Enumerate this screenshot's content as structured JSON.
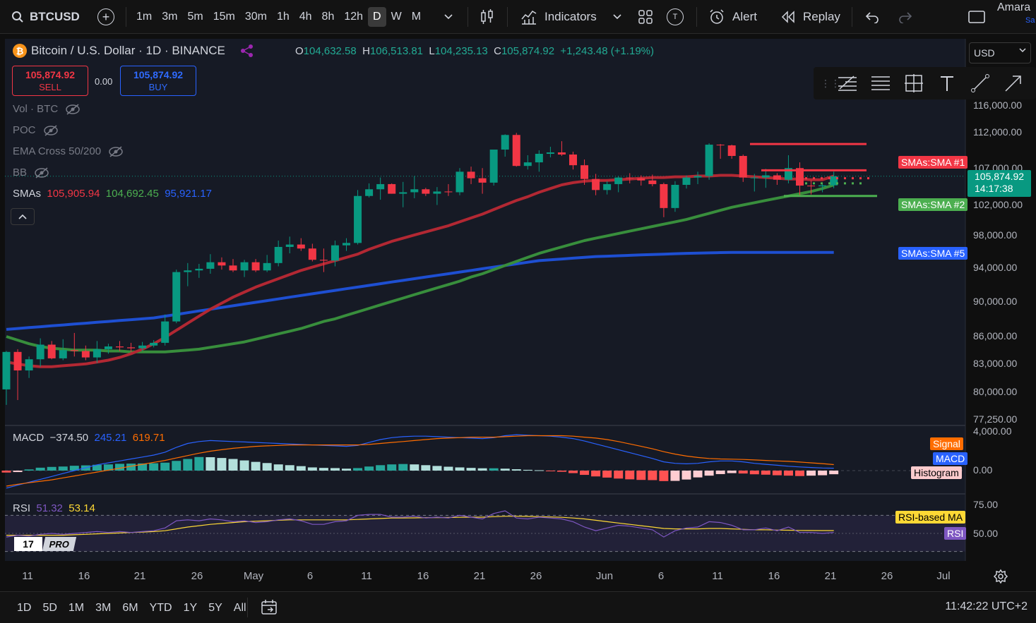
{
  "toolbar": {
    "symbol": "BTCUSD",
    "intervals": [
      "1m",
      "3m",
      "5m",
      "15m",
      "30m",
      "1h",
      "4h",
      "8h",
      "12h",
      "D",
      "W",
      "M"
    ],
    "active_interval": "D",
    "indicators_label": "Indicators",
    "t_label": "T",
    "alert_label": "Alert",
    "replay_label": "Replay",
    "user_name": "Amara",
    "user_sub": "Sa"
  },
  "legend": {
    "title": "Bitcoin / U.S. Dollar · 1D · BINANCE",
    "open_label": "O",
    "open": "104,632.58",
    "high_label": "H",
    "high": "106,513.81",
    "low_label": "L",
    "low": "104,235.13",
    "close_label": "C",
    "close": "105,874.92",
    "change": "+1,243.48 (+1.19%)"
  },
  "trade": {
    "sell_price": "105,874.92",
    "sell_label": "SELL",
    "buy_price": "105,874.92",
    "buy_label": "BUY",
    "spread": "0.00"
  },
  "indicators": {
    "vol": "Vol · BTC",
    "poc": "POC",
    "ema": "EMA Cross 50/200",
    "bb": "BB",
    "smas_label": "SMAs",
    "sma1": "105,905.94",
    "sma2": "104,692.45",
    "sma5": "95,921.17"
  },
  "currency_select": "USD",
  "y_axis": {
    "labels": [
      "116,000.00",
      "112,000.00",
      "107,000.00",
      "102,000.00",
      "98,000.00",
      "94,000.00",
      "90,000.00",
      "86,000.00",
      "83,000.00",
      "80,000.00",
      "77,250.00"
    ],
    "tags": {
      "sma1": "SMAs:SMA #1",
      "sma2": "SMAs:SMA #2",
      "sma5": "SMAs:SMA #5"
    },
    "last_price": "105,874.92",
    "countdown": "14:17:38"
  },
  "colors": {
    "up": "#089981",
    "down": "#f23645",
    "sma1": "#b22833",
    "sma2": "#388e3c",
    "sma5": "#1e4fd2",
    "macd": "#2962ff",
    "signal": "#ff6d00",
    "rsi": "#7e57c2",
    "rsi_ma": "#fdd835"
  },
  "macd": {
    "label": "MACD",
    "hist": "−374.50",
    "macd": "245.21",
    "signal": "619.71",
    "axis_top": "4,000.00",
    "axis_zero": "0.00",
    "tags": {
      "signal": "Signal",
      "macd": "MACD",
      "histogram": "Histogram"
    }
  },
  "rsi": {
    "label": "RSI",
    "rsi": "51.32",
    "ma": "53.14",
    "axis_75": "75.00",
    "axis_50": "50.00",
    "tags": {
      "ma": "RSI-based MA",
      "rsi": "RSI"
    }
  },
  "x_axis": {
    "labels": [
      "11",
      "16",
      "21",
      "26",
      "May",
      "6",
      "11",
      "16",
      "21",
      "26",
      "Jun",
      "6",
      "11",
      "16",
      "21",
      "26",
      "Jul"
    ]
  },
  "pro_badge": "PRO",
  "bottom": {
    "ranges": [
      "1D",
      "5D",
      "1M",
      "3M",
      "6M",
      "YTD",
      "1Y",
      "5Y",
      "All"
    ],
    "clock": "11:42:22 UTC+2"
  },
  "chart_data": {
    "type": "candlestick",
    "title": "Bitcoin / U.S. Dollar · 1D · BINANCE",
    "candles": [
      [
        80300,
        84400,
        78700,
        84300
      ],
      [
        84300,
        84600,
        79200,
        82300
      ],
      [
        82300,
        83800,
        81500,
        83500
      ],
      [
        83500,
        85800,
        82700,
        85100
      ],
      [
        85100,
        85500,
        83500,
        83600
      ],
      [
        83600,
        85700,
        83400,
        84500
      ],
      [
        84500,
        86400,
        83800,
        84400
      ],
      [
        84400,
        85000,
        83400,
        83700
      ],
      [
        83700,
        85500,
        83100,
        84600
      ],
      [
        84600,
        85200,
        84100,
        84900
      ],
      [
        84900,
        85500,
        84400,
        84800
      ],
      [
        84800,
        85300,
        84300,
        84700
      ],
      [
        84700,
        85400,
        84400,
        85000
      ],
      [
        85000,
        85600,
        84800,
        85300
      ],
      [
        85300,
        88500,
        85000,
        87700
      ],
      [
        87700,
        93800,
        87500,
        93500
      ],
      [
        93500,
        94600,
        91800,
        93700
      ],
      [
        93700,
        94500,
        92800,
        93900
      ],
      [
        93900,
        95700,
        93300,
        94700
      ],
      [
        94700,
        95300,
        93800,
        94300
      ],
      [
        94300,
        95100,
        93500,
        93700
      ],
      [
        93700,
        95000,
        92900,
        94700
      ],
      [
        94700,
        95100,
        93500,
        93700
      ],
      [
        93700,
        95600,
        93500,
        94600
      ],
      [
        94600,
        97400,
        94200,
        96600
      ],
      [
        96600,
        97900,
        95800,
        96900
      ],
      [
        96900,
        97700,
        96100,
        96400
      ],
      [
        96400,
        97000,
        94800,
        95000
      ],
      [
        95000,
        96400,
        93500,
        94900
      ],
      [
        94900,
        97400,
        94200,
        96800
      ],
      [
        96800,
        97700,
        96100,
        97100
      ],
      [
        97100,
        104000,
        96900,
        103200
      ],
      [
        103200,
        104900,
        103000,
        104100
      ],
      [
        104100,
        105700,
        102700,
        104800
      ],
      [
        104800,
        104900,
        103500,
        103500
      ],
      [
        103500,
        105100,
        101700,
        103700
      ],
      [
        103700,
        105900,
        102900,
        104100
      ],
      [
        104100,
        104300,
        103200,
        103500
      ],
      [
        103500,
        104400,
        102000,
        103800
      ],
      [
        103800,
        104800,
        103200,
        103700
      ],
      [
        103700,
        107000,
        103300,
        106500
      ],
      [
        106500,
        107200,
        104800,
        105600
      ],
      [
        105600,
        107000,
        103500,
        105000
      ],
      [
        105000,
        109500,
        104600,
        109600
      ],
      [
        109600,
        111800,
        108600,
        111700
      ],
      [
        111700,
        112000,
        107200,
        107300
      ],
      [
        107300,
        108800,
        106800,
        107800
      ],
      [
        107800,
        109500,
        106500,
        109000
      ],
      [
        109000,
        110000,
        108500,
        109200
      ],
      [
        109200,
        110800,
        108700,
        108900
      ],
      [
        108900,
        109300,
        106800,
        107400
      ],
      [
        107400,
        108200,
        104700,
        105500
      ],
      [
        105500,
        106200,
        103300,
        104000
      ],
      [
        104000,
        105200,
        103400,
        104800
      ],
      [
        104800,
        105900,
        103700,
        105700
      ],
      [
        105700,
        106300,
        104900,
        105600
      ],
      [
        105600,
        106000,
        104600,
        105300
      ],
      [
        105300,
        106100,
        104500,
        104800
      ],
      [
        104800,
        105000,
        100400,
        101600
      ],
      [
        101600,
        105200,
        101100,
        104700
      ],
      [
        104700,
        106000,
        104200,
        105700
      ],
      [
        105700,
        106500,
        104800,
        105900
      ],
      [
        105900,
        110500,
        105400,
        110300
      ],
      [
        110300,
        110400,
        108300,
        110200
      ],
      [
        110200,
        110300,
        108300,
        108700
      ],
      [
        108700,
        108900,
        105100,
        105700
      ],
      [
        105700,
        106200,
        103800,
        105700
      ],
      [
        105700,
        106900,
        104300,
        106000
      ],
      [
        106000,
        106300,
        104700,
        105400
      ],
      [
        105400,
        108800,
        104900,
        107000
      ],
      [
        107000,
        107800,
        103200,
        104600
      ],
      [
        104600,
        105300,
        103400,
        104500
      ],
      [
        104500,
        105000,
        103700,
        104632
      ],
      [
        104632,
        106514,
        104235,
        105875
      ]
    ],
    "sma1": [
      83200,
      83000,
      82800,
      82700,
      82700,
      82800,
      82900,
      83000,
      83200,
      83400,
      83700,
      84100,
      84600,
      85200,
      85900,
      86700,
      87500,
      88300,
      89100,
      89800,
      90500,
      91100,
      91700,
      92200,
      92700,
      93200,
      93700,
      94100,
      94500,
      94900,
      95300,
      95700,
      96300,
      96800,
      97300,
      97700,
      98100,
      98500,
      98900,
      99300,
      99800,
      100300,
      100800,
      101400,
      102000,
      102600,
      103100,
      103700,
      104200,
      104700,
      105000,
      105200,
      105300,
      105300,
      105400,
      105500,
      105600,
      105700,
      105700,
      105800,
      105800,
      105900,
      105900,
      106000,
      106000,
      105900,
      105800,
      105700,
      105600,
      105500,
      105500,
      105400,
      105400,
      105906
    ],
    "sma2": [
      86000,
      85600,
      85200,
      84900,
      84700,
      84600,
      84500,
      84500,
      84500,
      84400,
      84400,
      84300,
      84300,
      84300,
      84300,
      84400,
      84500,
      84600,
      84800,
      85000,
      85200,
      85400,
      85700,
      86000,
      86300,
      86600,
      86900,
      87300,
      87700,
      88000,
      88400,
      88800,
      89200,
      89600,
      90000,
      90400,
      90800,
      91200,
      91600,
      92000,
      92400,
      92900,
      93300,
      93800,
      94300,
      94800,
      95300,
      95800,
      96200,
      96600,
      97000,
      97400,
      97700,
      98000,
      98300,
      98600,
      98900,
      99200,
      99500,
      99800,
      100100,
      100500,
      100900,
      101300,
      101700,
      102000,
      102300,
      102600,
      102900,
      103200,
      103500,
      103800,
      104200,
      104692
    ],
    "sma5": [
      86800,
      86900,
      87000,
      87100,
      87200,
      87300,
      87400,
      87500,
      87600,
      87700,
      87800,
      87900,
      88000,
      88100,
      88300,
      88500,
      88700,
      88900,
      89100,
      89300,
      89500,
      89700,
      89900,
      90100,
      90300,
      90500,
      90700,
      90900,
      91100,
      91300,
      91500,
      91700,
      91900,
      92100,
      92300,
      92500,
      92700,
      92900,
      93100,
      93300,
      93500,
      93700,
      93900,
      94100,
      94300,
      94500,
      94700,
      94900,
      95000,
      95100,
      95200,
      95300,
      95400,
      95450,
      95500,
      95550,
      95600,
      95650,
      95700,
      95750,
      95800,
      95830,
      95860,
      95890,
      95920,
      95921,
      95921,
      95921,
      95921,
      95921,
      95921,
      95921,
      95921,
      95921
    ],
    "macd_hist": [
      -200,
      -150,
      120,
      300,
      380,
      420,
      500,
      540,
      600,
      640,
      700,
      720,
      740,
      760,
      820,
      1000,
      1200,
      1400,
      1380,
      1300,
      1200,
      1050,
      900,
      780,
      640,
      560,
      460,
      330,
      280,
      260,
      200,
      260,
      420,
      560,
      640,
      680,
      640,
      560,
      480,
      400,
      330,
      280,
      240,
      240,
      200,
      140,
      80,
      40,
      -40,
      -120,
      -260,
      -440,
      -600,
      -720,
      -820,
      -900,
      -960,
      -980,
      -1080,
      -1060,
      -920,
      -700,
      -520,
      -360,
      -260,
      -300,
      -380,
      -420,
      -480,
      -520,
      -560,
      -520,
      -480,
      -374
    ],
    "macd_line": [
      -1800,
      -1500,
      -1200,
      -900,
      -600,
      -300,
      0,
      300,
      600,
      800,
      1000,
      1200,
      1400,
      1600,
      1900,
      2400,
      2800,
      3000,
      3100,
      3050,
      3000,
      2950,
      2900,
      2850,
      2800,
      2750,
      2700,
      2650,
      2600,
      2550,
      2500,
      2600,
      2900,
      3200,
      3400,
      3500,
      3550,
      3550,
      3500,
      3450,
      3400,
      3350,
      3300,
      3400,
      3600,
      3700,
      3650,
      3600,
      3550,
      3450,
      3300,
      3050,
      2750,
      2450,
      2150,
      1850,
      1550,
      1250,
      900,
      750,
      700,
      750,
      900,
      1000,
      1000,
      900,
      750,
      650,
      550,
      450,
      380,
      320,
      270,
      245
    ],
    "signal_line": [
      -1600,
      -1400,
      -1250,
      -1100,
      -950,
      -750,
      -550,
      -350,
      -150,
      50,
      250,
      450,
      650,
      850,
      1050,
      1300,
      1550,
      1800,
      2000,
      2150,
      2300,
      2400,
      2500,
      2550,
      2600,
      2650,
      2650,
      2650,
      2650,
      2650,
      2650,
      2650,
      2700,
      2800,
      2900,
      3000,
      3100,
      3200,
      3300,
      3350,
      3400,
      3450,
      3450,
      3450,
      3500,
      3550,
      3600,
      3600,
      3600,
      3600,
      3550,
      3450,
      3350,
      3200,
      3000,
      2750,
      2500,
      2250,
      1950,
      1700,
      1500,
      1350,
      1250,
      1200,
      1180,
      1150,
      1100,
      1050,
      1000,
      950,
      880,
      800,
      720,
      620
    ],
    "rsi": [
      46,
      48,
      47,
      49,
      50,
      49,
      50,
      51,
      52,
      51,
      52,
      51,
      52,
      53,
      56,
      64,
      65,
      64,
      66,
      65,
      63,
      64,
      62,
      63,
      65,
      66,
      64,
      60,
      60,
      63,
      64,
      70,
      71,
      71,
      68,
      68,
      69,
      67,
      68,
      67,
      70,
      68,
      66,
      72,
      75,
      67,
      66,
      68,
      67,
      66,
      63,
      57,
      53,
      56,
      59,
      58,
      56,
      54,
      46,
      53,
      56,
      57,
      63,
      62,
      59,
      54,
      54,
      56,
      53,
      57,
      51,
      51,
      50,
      51
    ],
    "rsi_ma": [
      48,
      48,
      48,
      48,
      48,
      48,
      48.5,
      49,
      49.5,
      50,
      50.5,
      51,
      51.5,
      52,
      53,
      55,
      57,
      58.5,
      60,
      61,
      62,
      63,
      63.5,
      64,
      64.5,
      65,
      65,
      65,
      65,
      65,
      65,
      65.5,
      66,
      66.5,
      67,
      67,
      67.2,
      67.4,
      67.5,
      67.6,
      67.8,
      68,
      68,
      68.5,
      69,
      69,
      68.8,
      68.5,
      68.2,
      67.8,
      67,
      66,
      64.5,
      63,
      61.5,
      60,
      58.5,
      57,
      55.5,
      55,
      55,
      55,
      55.5,
      55.5,
      55,
      54.5,
      54,
      54,
      53.7,
      53.5,
      53.3,
      53.2,
      53.1,
      53.14
    ],
    "levels": {
      "resistance_top": 110400,
      "resistance_mid": 106700,
      "dotted_red": 105600,
      "dotted_green": 104900,
      "support": 103200
    },
    "ylim": [
      77250,
      118000
    ]
  }
}
